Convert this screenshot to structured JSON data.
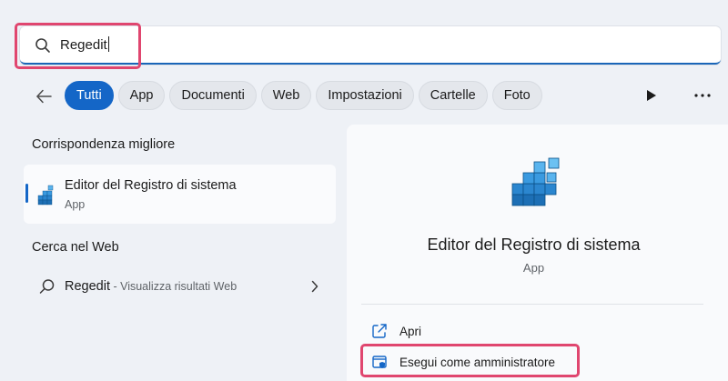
{
  "search": {
    "query": "Regedit"
  },
  "filters": [
    {
      "label": "Tutti",
      "active": true
    },
    {
      "label": "App",
      "active": false
    },
    {
      "label": "Documenti",
      "active": false
    },
    {
      "label": "Web",
      "active": false
    },
    {
      "label": "Impostazioni",
      "active": false
    },
    {
      "label": "Cartelle",
      "active": false
    },
    {
      "label": "Foto",
      "active": false
    }
  ],
  "left": {
    "best_match_heading": "Corrispondenza migliore",
    "best_match": {
      "name": "Editor del Registro di sistema",
      "type": "App"
    },
    "web_heading": "Cerca nel Web",
    "web_result": {
      "query": "Regedit",
      "suffix": " - Visualizza risultati Web"
    }
  },
  "detail": {
    "title": "Editor del Registro di sistema",
    "type": "App",
    "actions": [
      {
        "label": "Apri",
        "icon": "open-external-icon"
      },
      {
        "label": "Esegui come amministratore",
        "icon": "shield-admin-icon"
      }
    ]
  },
  "colors": {
    "accent": "#1466c7",
    "highlight": "#e0466f"
  }
}
